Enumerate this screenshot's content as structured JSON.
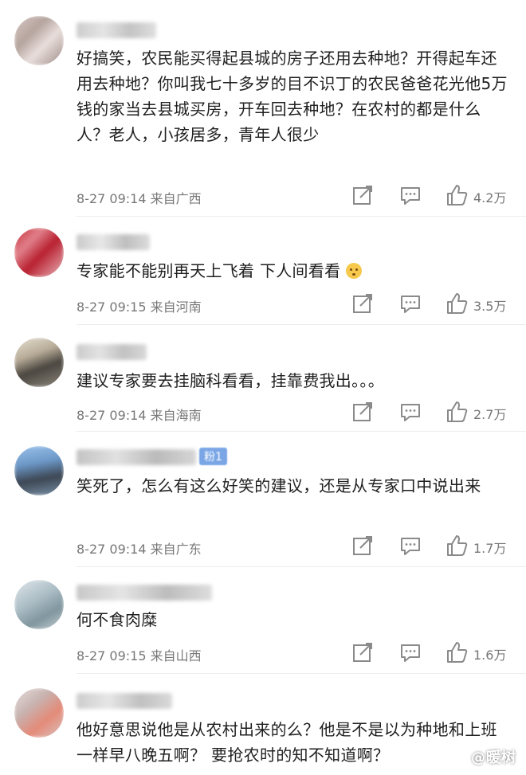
{
  "comments": [
    {
      "text": "好搞笑，农民能买得起县城的房子还用去种地？开得起车还用去种地？你叫我七十多岁的目不识丁的农民爸爸花光他5万钱的家当去县城买房，开车回去种地？在农村的都是什么人？老人，小孩居多，青年人很少",
      "meta": "8-27 09:14 来自广西",
      "likes": "4.2万"
    },
    {
      "text": "专家能不能别再天上飞着 下人间看看",
      "emoji": "flushed-face-emoji",
      "meta": "8-27 09:15 来自河南",
      "likes": "3.5万"
    },
    {
      "text": "建议专家要去挂脑科看看，挂靠费我出。。。",
      "meta": "8-27 09:14 来自海南",
      "likes": "2.7万"
    },
    {
      "badge": "粉1",
      "text": "笑死了，怎么有这么好笑的建议，还是从专家口中说出来",
      "meta": "8-27 09:14 来自广东",
      "likes": "1.7万"
    },
    {
      "text": "何不食肉糜",
      "meta": "8-27 09:15 来自山西",
      "likes": "1.6万"
    },
    {
      "text": "他好意思说他是从农村出来的么？他是不是以为种地和上班一样早八晚五啊？ 要抢农时的知不知道啊？",
      "meta": "",
      "likes": ""
    }
  ],
  "icons": {
    "share": "share-icon",
    "reply": "comment-icon",
    "like": "thumbs-up-icon"
  },
  "watermark": "@暖树",
  "colors": {
    "text": "#1f1f1f",
    "meta": "#777777",
    "icon": "#8a8a8a",
    "badge": "#7aa6e6"
  }
}
